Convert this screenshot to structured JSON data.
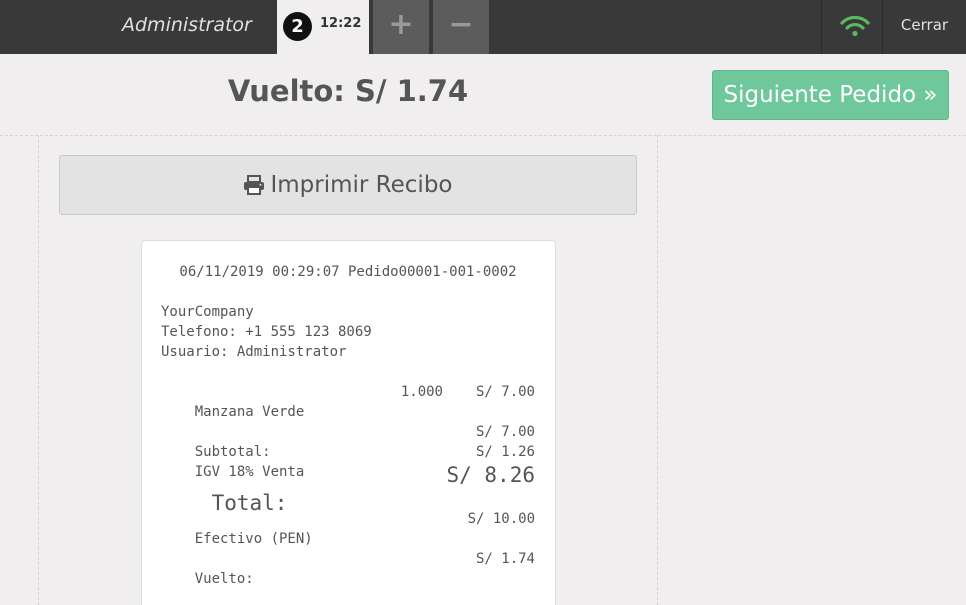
{
  "topbar": {
    "user_name": "Administrator",
    "order_number": "2",
    "order_time": "12:22",
    "add_label": "+",
    "remove_label": "−",
    "close_label": "Cerrar",
    "wifi_icon": "wifi-icon",
    "wifi_color": "#5cb85c"
  },
  "header": {
    "change_text": "Vuelto: S/ 1.74",
    "next_label": "Siguiente Pedido »",
    "next_color": "#6ec89b"
  },
  "print_button": {
    "label": "Imprimir Recibo",
    "icon": "printer-icon"
  },
  "receipt": {
    "header_line": "06/11/2019 00:29:07 Pedido00001-001-0002",
    "company": "YourCompany",
    "phone": "Telefono: +1 555 123 8069",
    "user": "Usuario: Administrator",
    "items": [
      {
        "name": "Manzana Verde",
        "qty": "1.000",
        "price": "S/ 7.00"
      }
    ],
    "subtotal_label": "Subtotal:",
    "subtotal_value": "S/ 7.00",
    "tax_label": "IGV 18% Venta",
    "tax_value": "S/ 1.26",
    "total_label": "Total:",
    "total_value": "S/ 8.26",
    "payment_label": "Efectivo (PEN)",
    "payment_value": "S/ 10.00",
    "change_label": "Vuelto:",
    "change_value": "S/ 1.74"
  }
}
